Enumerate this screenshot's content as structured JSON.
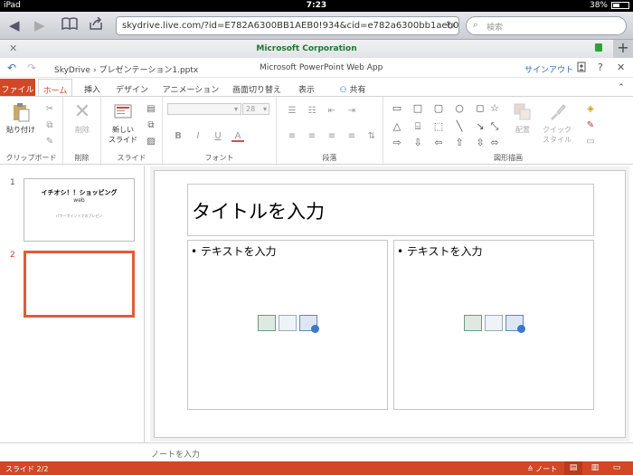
{
  "ios": {
    "device": "iPad",
    "time": "7:23",
    "battery": "38%",
    "battery_level": 0.38
  },
  "safari": {
    "url": "skydrive.live.com/?id=E782A6300BB1AEB0!934&cid=e782a6300bb1aeb0&#!/",
    "search_placeholder": "検索",
    "tab_title": "Microsoft Corporation"
  },
  "app": {
    "breadcrumb_root": "SkyDrive",
    "breadcrumb_sep": "›",
    "file_name": "プレゼンテーション1.pptx",
    "app_name": "Microsoft PowerPoint Web App",
    "sign_out": "サインアウト",
    "help": "?",
    "close": "✕"
  },
  "ribbon_tabs": {
    "file": "ファイル",
    "home": "ホーム",
    "insert": "挿入",
    "design": "デザイン",
    "animation": "アニメーション",
    "transition": "画面切り替え",
    "view": "表示",
    "share": "共有"
  },
  "ribbon": {
    "clipboard": {
      "paste": "貼り付け",
      "group": "クリップボード"
    },
    "delete": {
      "button": "削除",
      "group": "削除"
    },
    "slides": {
      "new_slide_1": "新しい",
      "new_slide_2": "スライド",
      "group": "スライド"
    },
    "font": {
      "size": "28",
      "bold": "B",
      "italic": "I",
      "underline": "U",
      "color": "A",
      "group": "フォント"
    },
    "paragraph": {
      "group": "段落"
    },
    "drawing": {
      "arrange": "配置",
      "quick_style_1": "クイック",
      "quick_style_2": "スタイル",
      "group": "図形描画"
    }
  },
  "thumbnails": [
    {
      "number": "1",
      "title": "イチオシ！！ショッピング",
      "subtitle": "web",
      "tiny": "パワーポイントでのプレゼン"
    },
    {
      "number": "2"
    }
  ],
  "slide": {
    "title_placeholder": "タイトルを入力",
    "left_text": "• テキストを入力",
    "right_text": "• テキストを入力"
  },
  "notes_placeholder": "ノートを入力",
  "status": {
    "slide_count": "スライド 2/2",
    "notes_btn": "ノート"
  }
}
